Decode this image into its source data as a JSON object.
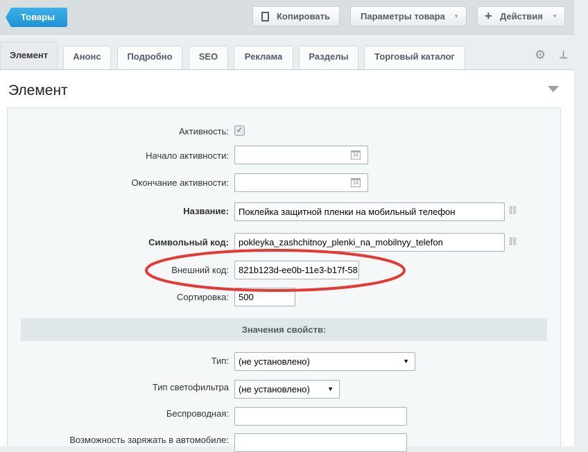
{
  "toolbar": {
    "back": "Товары",
    "copy": "Копировать",
    "params": "Параметры товара",
    "actions": "Действия"
  },
  "tabs": [
    "Элемент",
    "Анонс",
    "Подробно",
    "SEO",
    "Реклама",
    "Разделы",
    "Торговый каталог"
  ],
  "section_title": "Элемент",
  "form": {
    "active_label": "Активность:",
    "active_checked": true,
    "start_label": "Начало активности:",
    "start_value": "",
    "end_label": "Окончание активности:",
    "end_value": "",
    "calendar_day": "24",
    "name_label": "Название:",
    "name_value": "Поклейка защитной пленки на мобильный телефон",
    "code_label": "Символьный код:",
    "code_value": "pokleyka_zashchitnoy_plenki_na_mobilnyy_telefon",
    "ext_label": "Внешний код:",
    "ext_value": "821b123d-ee0b-11e3-b17f-58",
    "sort_label": "Сортировка:",
    "sort_value": "500"
  },
  "props": {
    "header": "Значения свойств:",
    "type_label": "Тип:",
    "type_value": "(не установлено)",
    "filter_label": "Тип светофильтра",
    "filter_value": "(не установлено)",
    "wireless_label": "Беспроводная:",
    "wireless_value": "",
    "car_label": "Возможность заряжать в автомобиле:",
    "car_value": ""
  },
  "annotation_color": "#e53935"
}
